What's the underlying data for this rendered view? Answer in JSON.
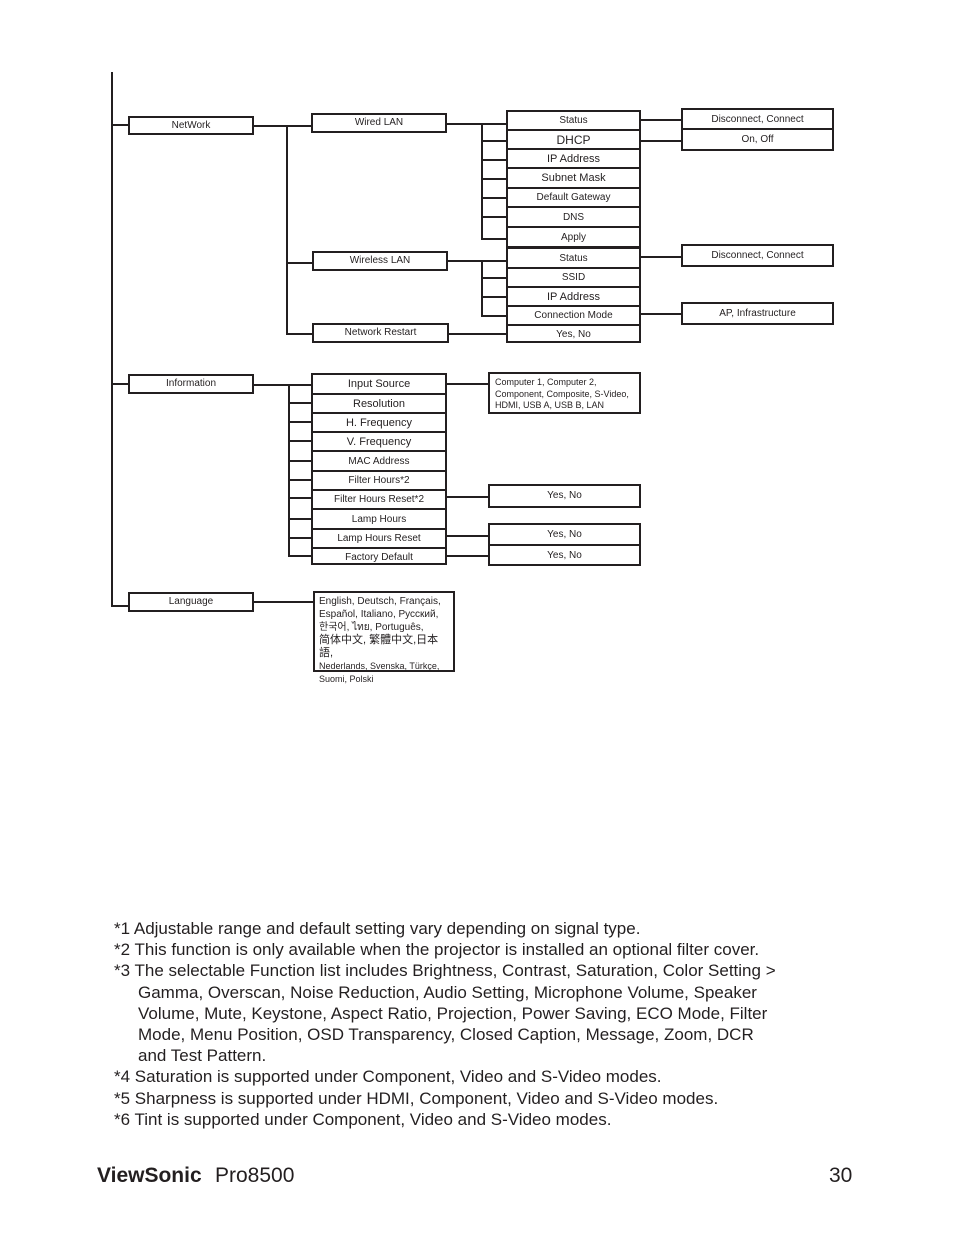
{
  "diagram": {
    "network": {
      "label": "NetWork",
      "wired_lan": {
        "label": "Wired LAN",
        "items": [
          "Status",
          "DHCP",
          "IP Address",
          "Subnet Mask",
          "Default Gateway",
          "DNS",
          "Apply"
        ],
        "options": {
          "status": "Disconnect, Connect",
          "dhcp": "On, Off"
        }
      },
      "wireless_lan": {
        "label": "Wireless LAN",
        "items": [
          "Status",
          "SSID",
          "IP Address",
          "Connection Mode"
        ],
        "options": {
          "status": "Disconnect, Connect",
          "connection_mode": "AP, Infrastructure"
        }
      },
      "network_restart": {
        "label": "Network Restart",
        "option": "Yes, No"
      }
    },
    "information": {
      "label": "Information",
      "items": [
        "Input Source",
        "Resolution",
        "H. Frequency",
        "V. Frequency",
        "MAC Address",
        "Filter Hours*2",
        "Filter Hours Reset*2",
        "Lamp Hours",
        "Lamp Hours Reset",
        "Factory Default"
      ],
      "options": {
        "input_source": "Computer  1, Computer 2, Component, Composite, S-Video, HDMI, USB A, USB B, LAN",
        "filter_hours_reset": "Yes, No",
        "lamp_hours_reset": "Yes, No",
        "factory_default": "Yes, No"
      }
    },
    "language": {
      "label": "Language",
      "options_lines": [
        "English, Deutsch, Français,",
        "Español, Italiano, Русский,",
        "한국어, ไทย, Português,",
        "简体中文, 繁體中文,日本語,",
        "Nederlands, Svenska, Türkçe,",
        "Suomi, Polski"
      ]
    }
  },
  "notes": [
    {
      "first": "*1 Adjustable range and default setting vary depending on signal type."
    },
    {
      "first": "*2 This function is only available when the projector is installed an optional filter cover."
    },
    {
      "first": "*3 The selectable Function list includes Brightness, Contrast, Saturation, Color Setting >",
      "cont": [
        "Gamma, Overscan, Noise Reduction, Audio Setting, Microphone Volume, Speaker",
        "Volume, Mute, Keystone, Aspect Ratio, Projection, Power Saving, ECO Mode, Filter",
        "Mode, Menu Position, OSD Transparency, Closed Caption, Message, Zoom, DCR",
        "and Test Pattern."
      ]
    },
    {
      "first": "*4 Saturation is supported under Component, Video and S-Video modes."
    },
    {
      "first": "*5 Sharpness is supported under HDMI, Component, Video and S-Video modes."
    },
    {
      "first": "*6 Tint is supported under Component, Video and S-Video modes."
    }
  ],
  "footer": {
    "brand": "ViewSonic",
    "model": "Pro8500",
    "page_number": "30"
  }
}
